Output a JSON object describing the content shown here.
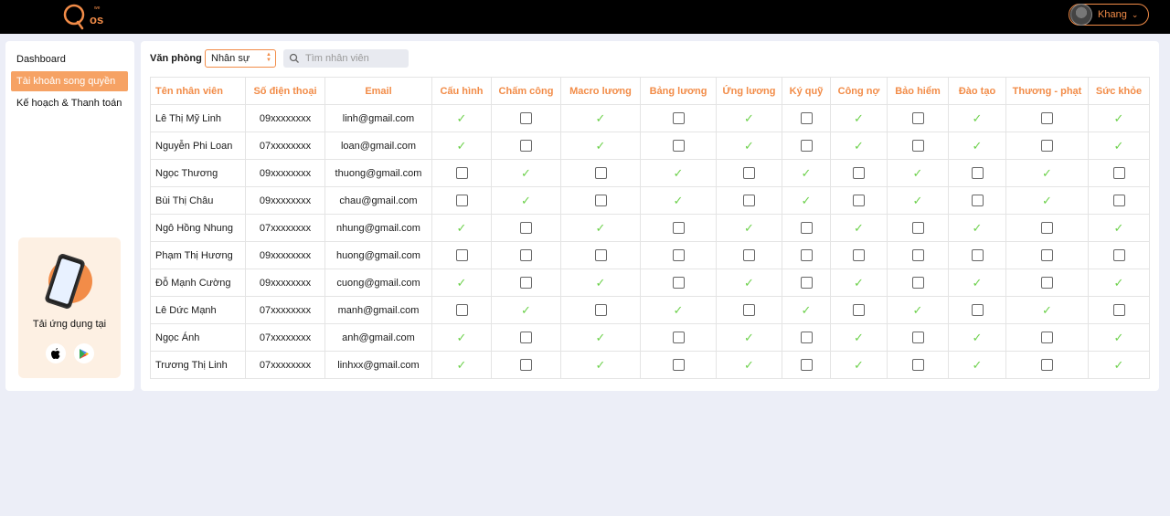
{
  "header": {
    "user_name": "Khang"
  },
  "sidebar": {
    "items": [
      {
        "label": "Dashboard",
        "active": false
      },
      {
        "label": "Tài khoản song quyền",
        "active": true
      },
      {
        "label": "Kế hoạch & Thanh toán",
        "active": false
      }
    ],
    "promo_text": "Tải ứng dụng tại"
  },
  "filters": {
    "office_label": "Văn phòng",
    "office_value": "Nhân sự",
    "search_placeholder": "Tìm nhân viên"
  },
  "table": {
    "columns": [
      "Tên nhân viên",
      "Số điện thoại",
      "Email",
      "Cấu hình",
      "Chấm công",
      "Macro lương",
      "Bảng lương",
      "Ứng lương",
      "Ký quỹ",
      "Công nợ",
      "Bảo hiểm",
      "Đào tạo",
      "Thương - phạt",
      "Sức khỏe"
    ],
    "rows": [
      {
        "name": "Lê Thị Mỹ Linh",
        "phone": "09xxxxxxxx",
        "email": "linh@gmail.com",
        "perms": [
          1,
          0,
          1,
          0,
          1,
          0,
          1,
          0,
          1,
          0,
          1
        ]
      },
      {
        "name": "Nguyễn Phi Loan",
        "phone": "07xxxxxxxx",
        "email": "loan@gmail.com",
        "perms": [
          1,
          0,
          1,
          0,
          1,
          0,
          1,
          0,
          1,
          0,
          1
        ]
      },
      {
        "name": "Ngọc Thương",
        "phone": "09xxxxxxxx",
        "email": "thuong@gmail.com",
        "perms": [
          0,
          1,
          0,
          1,
          0,
          1,
          0,
          1,
          0,
          1,
          0
        ]
      },
      {
        "name": "Bùi Thị Châu",
        "phone": "09xxxxxxxx",
        "email": "chau@gmail.com",
        "perms": [
          0,
          1,
          0,
          1,
          0,
          1,
          0,
          1,
          0,
          1,
          0
        ]
      },
      {
        "name": "Ngô Hồng Nhung",
        "phone": "07xxxxxxxx",
        "email": "nhung@gmail.com",
        "perms": [
          1,
          0,
          1,
          0,
          1,
          0,
          1,
          0,
          1,
          0,
          1
        ]
      },
      {
        "name": "Phạm Thị Hương",
        "phone": "09xxxxxxxx",
        "email": "huong@gmail.com",
        "perms": [
          0,
          0,
          0,
          0,
          0,
          0,
          0,
          0,
          0,
          0,
          0
        ]
      },
      {
        "name": "Đỗ Mạnh Cường",
        "phone": "09xxxxxxxx",
        "email": "cuong@gmail.com",
        "perms": [
          1,
          0,
          1,
          0,
          1,
          0,
          1,
          0,
          1,
          0,
          1
        ]
      },
      {
        "name": "Lê Dức Mạnh",
        "phone": "07xxxxxxxx",
        "email": "manh@gmail.com",
        "perms": [
          0,
          1,
          0,
          1,
          0,
          1,
          0,
          1,
          0,
          1,
          0
        ]
      },
      {
        "name": "Ngọc Ánh",
        "phone": "07xxxxxxxx",
        "email": "anh@gmail.com",
        "perms": [
          1,
          0,
          1,
          0,
          1,
          0,
          1,
          0,
          1,
          0,
          1
        ]
      },
      {
        "name": "Trương Thị Linh",
        "phone": "07xxxxxxxx",
        "email": "linhxx@gmail.com",
        "perms": [
          1,
          0,
          1,
          0,
          1,
          0,
          1,
          0,
          1,
          0,
          1
        ]
      }
    ]
  },
  "colors": {
    "accent": "#f28c48",
    "check": "#6dd14c",
    "background": "#eceef7"
  }
}
